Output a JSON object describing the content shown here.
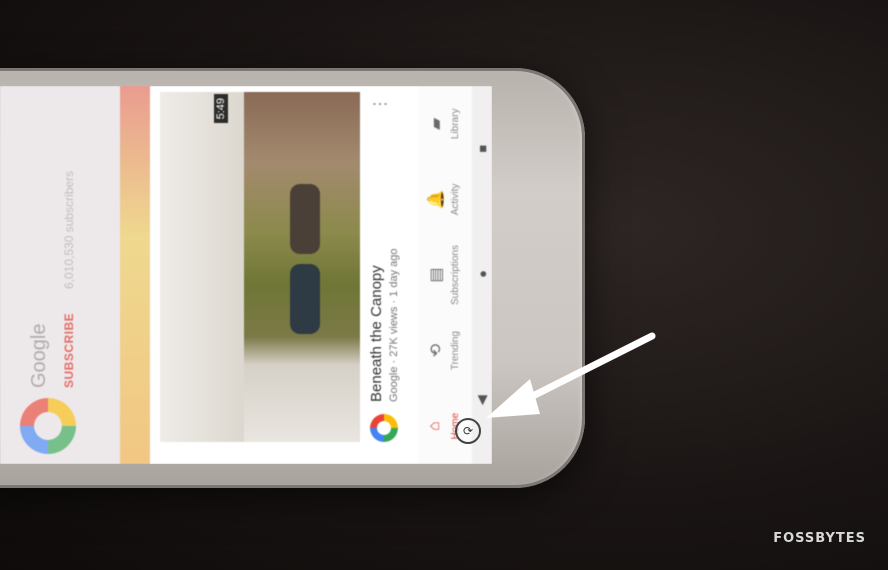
{
  "channel": {
    "name": "Google",
    "subscribe_label": "SUBSCRIBE",
    "subscribers": "6,010,530 subscribers"
  },
  "video": {
    "duration": "5:49",
    "title": "Beneath the Canopy",
    "meta": "Google · 27K views · 1 day ago",
    "more_glyph": "⋮"
  },
  "bottom_nav": {
    "items": [
      {
        "label": "Home",
        "glyph": "⌂",
        "icon": "home-icon"
      },
      {
        "label": "Trending",
        "glyph": "⟲",
        "icon": "trending-icon"
      },
      {
        "label": "Subscriptions",
        "glyph": "▤",
        "icon": "subscriptions-icon"
      },
      {
        "label": "Activity",
        "glyph": "🔔",
        "icon": "bell-icon"
      },
      {
        "label": "Library",
        "glyph": "▰",
        "icon": "library-icon"
      }
    ]
  },
  "system_nav": {
    "back": "◀",
    "home": "●",
    "recents": "■"
  },
  "rotate_glyph": "⟳",
  "watermark": "FOSSBYTES",
  "colors": {
    "accent": "#e0413a",
    "arrow": "#ffffff"
  }
}
